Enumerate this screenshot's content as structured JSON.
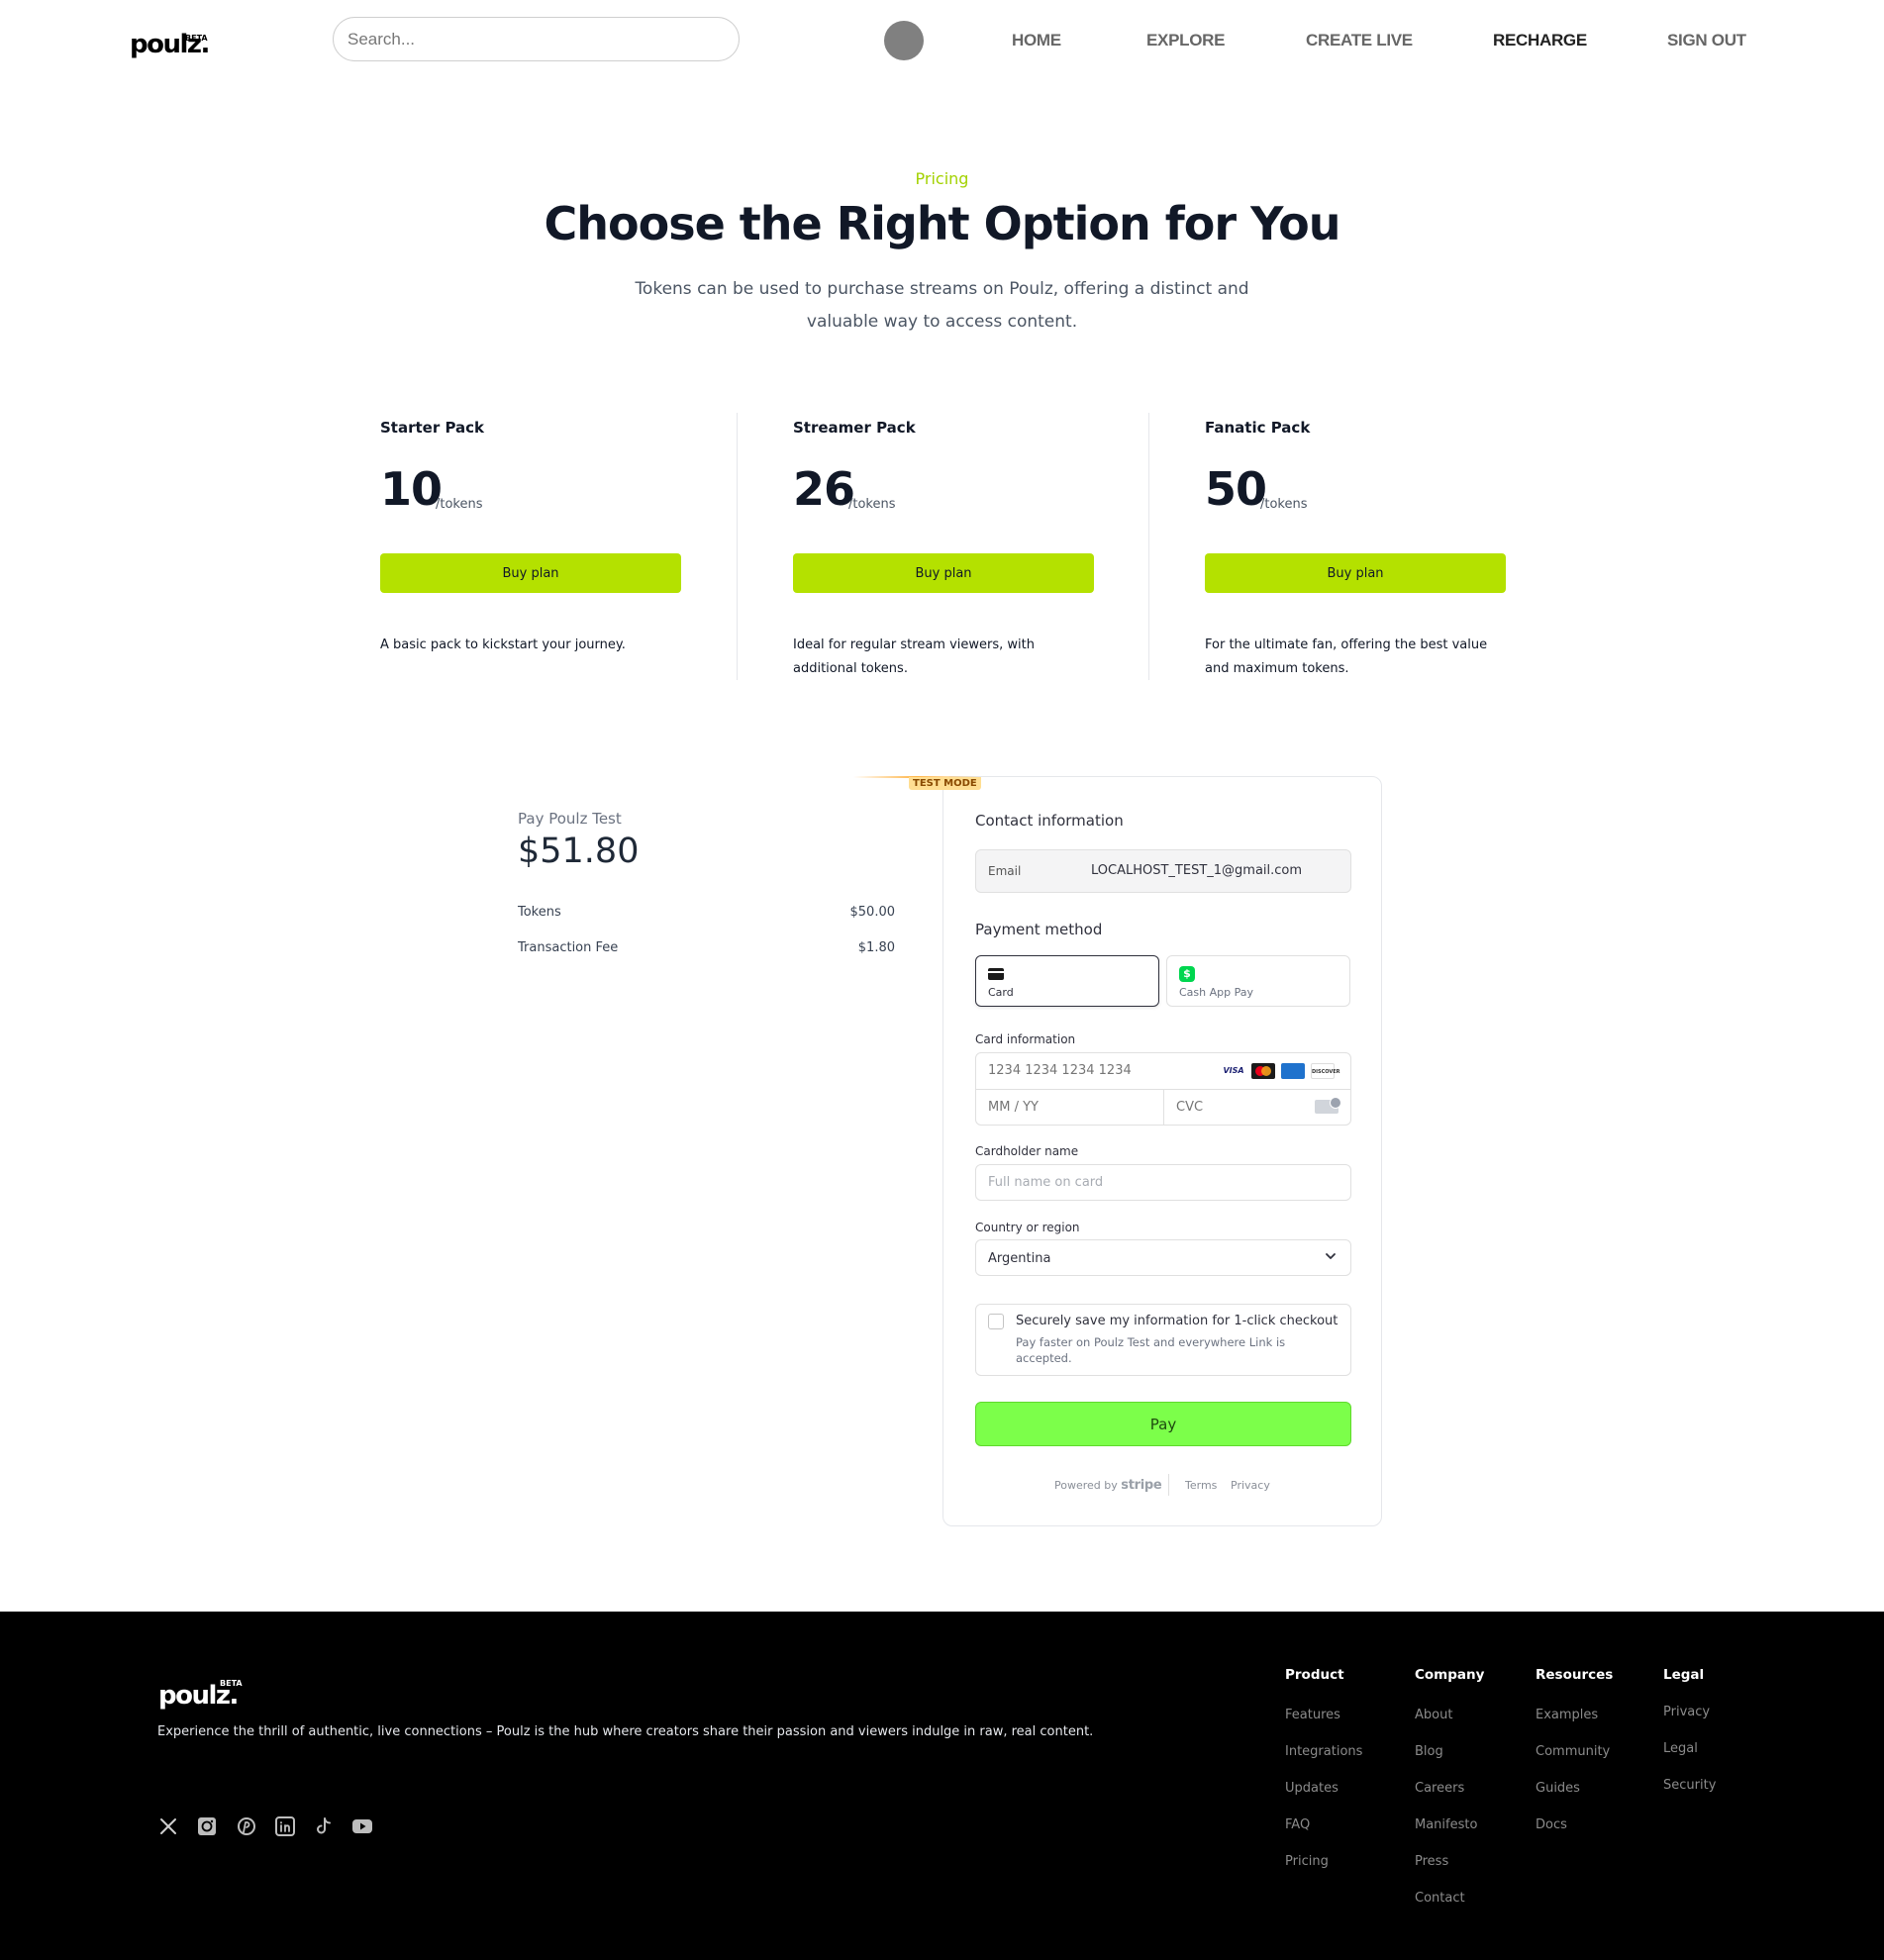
{
  "header": {
    "logo": "poulz.",
    "beta": "BETA",
    "search_placeholder": "Search...",
    "nav": [
      "HOME",
      "EXPLORE",
      "CREATE LIVE",
      "RECHARGE",
      "SIGN OUT"
    ],
    "active_nav": "RECHARGE"
  },
  "hero": {
    "eyebrow": "Pricing",
    "title": "Choose the Right Option for You",
    "subtitle": "Tokens can be used to purchase streams on Poulz, offering a distinct and valuable way to access content."
  },
  "plans": [
    {
      "name": "Starter Pack",
      "price": "10",
      "unit": "/tokens",
      "button": "Buy plan",
      "description": "A basic pack to kickstart your journey."
    },
    {
      "name": "Streamer Pack",
      "price": "26",
      "unit": "/tokens",
      "button": "Buy plan",
      "description": "Ideal for regular stream viewers, with additional tokens."
    },
    {
      "name": "Fanatic Pack",
      "price": "50",
      "unit": "/tokens",
      "button": "Buy plan",
      "description": "For the ultimate fan, offering the best value and maximum tokens."
    }
  ],
  "checkout": {
    "pay_label": "Pay Poulz Test",
    "amount": "$51.80",
    "lines": [
      {
        "label": "Tokens",
        "amount": "$50.00"
      },
      {
        "label": "Transaction Fee",
        "amount": "$1.80"
      }
    ]
  },
  "stripe": {
    "test_mode": "TEST MODE",
    "contact_heading": "Contact information",
    "email_label": "Email",
    "email_value": "LOCALHOST_TEST_1@gmail.com",
    "payment_heading": "Payment method",
    "methods": [
      "Card",
      "Cash App Pay"
    ],
    "selected_method": "Card",
    "card_info_label": "Card information",
    "card_number_placeholder": "1234 1234 1234 1234",
    "expiry_placeholder": "MM / YY",
    "cvc_placeholder": "CVC",
    "card_brands": [
      "VISA",
      "Mastercard",
      "AMEX",
      "DISCOVER"
    ],
    "cardholder_label": "Cardholder name",
    "cardholder_placeholder": "Full name on card",
    "country_label": "Country or region",
    "country_value": "Argentina",
    "save_title": "Securely save my information for 1-click checkout",
    "save_sub": "Pay faster on Poulz Test and everywhere Link is accepted.",
    "save_checked": false,
    "pay_button": "Pay",
    "powered_by": "Powered by",
    "stripe_word": "stripe",
    "terms": "Terms",
    "privacy": "Privacy",
    "accent_color": "#7cff4a"
  },
  "footer": {
    "logo": "poulz.",
    "beta": "BETA",
    "tagline": "Experience the thrill of authentic, live connections – Poulz is the hub where creators share their passion and viewers indulge in raw, real content.",
    "socials": [
      "x-icon",
      "instagram-icon",
      "pinterest-icon",
      "linkedin-icon",
      "tiktok-icon",
      "youtube-icon"
    ],
    "columns": [
      {
        "heading": "Product",
        "links": [
          "Features",
          "Integrations",
          "Updates",
          "FAQ",
          "Pricing"
        ]
      },
      {
        "heading": "Company",
        "links": [
          "About",
          "Blog",
          "Careers",
          "Manifesto",
          "Press",
          "Contact"
        ]
      },
      {
        "heading": "Resources",
        "links": [
          "Examples",
          "Community",
          "Guides",
          "Docs"
        ]
      },
      {
        "heading": "Legal",
        "links": [
          "Privacy",
          "Legal",
          "Security"
        ]
      }
    ]
  },
  "colors": {
    "brand_lime": "#b4e100",
    "eyebrow_lime": "#a3d200",
    "pay_green": "#7cff4a",
    "footer_bg": "#000000"
  }
}
